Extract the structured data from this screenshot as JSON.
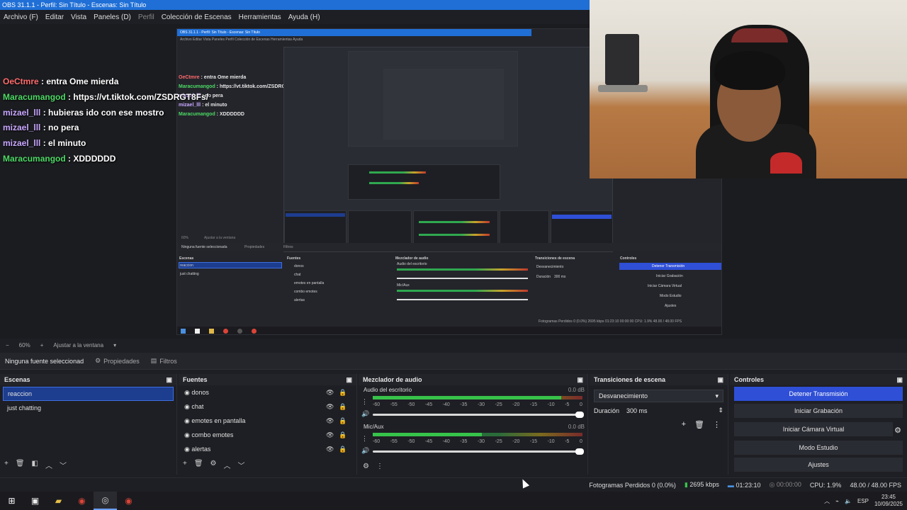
{
  "window": {
    "title": "OBS 31.1.1 - Perfil: Sin Título - Escenas: Sin Título"
  },
  "menu": [
    "Archivo (F)",
    "Editar",
    "Vista",
    "Paneles (D)",
    "Perfil",
    "Colección de Escenas",
    "Herramientas",
    "Ayuda (H)"
  ],
  "chat": [
    {
      "user": "OeCtmre",
      "sep": " : ",
      "msg": "entra Ome mierda",
      "color": "#ff6b6b"
    },
    {
      "user": "Maracumangod",
      "sep": " : ",
      "msg": "https://vt.tiktok.com/ZSDRGT8Fs/",
      "color": "#4cd964"
    },
    {
      "user": "mizael_lll",
      "sep": " : ",
      "msg": "hubieras ido con ese mostro",
      "color": "#c9a7ff"
    },
    {
      "user": "mizael_lll",
      "sep": " : ",
      "msg": "no pera",
      "color": "#c9a7ff"
    },
    {
      "user": "mizael_lll",
      "sep": " : ",
      "msg": "el minuto",
      "color": "#c9a7ff"
    },
    {
      "user": "Maracumangod",
      "sep": " : ",
      "msg": "XDDDDDD",
      "color": "#4cd964"
    }
  ],
  "zoom": {
    "level": "60%",
    "fit": "Ajustar a la ventana"
  },
  "props": {
    "no_source": "Ninguna fuente seleccionad",
    "properties": "Propiedades",
    "filters": "Filtros"
  },
  "scenes": {
    "title": "Escenas",
    "items": [
      "reaccion",
      "just chatting"
    ],
    "selected": 0
  },
  "sources": {
    "title": "Fuentes",
    "items": [
      "donos",
      "chat",
      "emotes en pantalla",
      "combo emotes",
      "alertas"
    ]
  },
  "mixer": {
    "title": "Mezclador de audio",
    "channels": [
      {
        "name": "Audio del escritorio",
        "db": "0.0 dB",
        "level": 0.9
      },
      {
        "name": "Mic/Aux",
        "db": "0.0 dB",
        "level": 0.52
      }
    ],
    "scale": [
      "-60",
      "-55",
      "-50",
      "-45",
      "-40",
      "-35",
      "-30",
      "-25",
      "-20",
      "-15",
      "-10",
      "-5",
      "0"
    ]
  },
  "transitions": {
    "title": "Transiciones de escena",
    "type": "Desvanecimiento",
    "duration_label": "Duración",
    "duration": "300 ms"
  },
  "controls": {
    "title": "Controles",
    "stop_stream": "Detener Transmisión",
    "start_rec": "Iniciar Grabación",
    "virtual_cam": "Iniciar Cámara Virtual",
    "studio": "Modo Estudio",
    "settings": "Ajustes"
  },
  "status": {
    "dropped": "Fotogramas Perdidos 0 (0.0%)",
    "bitrate": "2695 kbps",
    "stream_time": "01:23:10",
    "rec_time": "00:00:00",
    "cpu": "CPU: 1.9%",
    "fps": "48.00 / 48.00 FPS"
  },
  "taskbar": {
    "lang": "ESP",
    "time": "23:45",
    "date": "10/09/2025"
  },
  "nested": {
    "title": "OBS 31.1.1 - Perfil: Sin Título - Escenas: Sin Título",
    "menu": "Archivo Editar Vista Paneles Perfil Colección de Escenas Herramientas Ayuda",
    "chat": [
      {
        "user": "OeCtmre",
        "msg": " : entra Ome mierda",
        "color": "#ff6b6b"
      },
      {
        "user": "Maracumangod",
        "msg": " : https://vt.tiktok.com/ZSDRGT8Fs/ : hubieras ido con ese mostro",
        "color": "#4cd964"
      },
      {
        "user": "mizael_lll",
        "msg": " : no pera",
        "color": "#c9a7ff"
      },
      {
        "user": "mizael_lll",
        "msg": " : el minuto",
        "color": "#c9a7ff"
      },
      {
        "user": "Maracumangod",
        "msg": " : XDDDDDD",
        "color": "#4cd964"
      }
    ],
    "no_source": "Ninguna fuente seleccionada",
    "props": "Propiedades",
    "filters": "Filtros",
    "zoom": "60%",
    "fit": "Ajustar a la ventana",
    "scenes_title": "Escenas",
    "scenes": [
      "reaccion",
      "just chatting"
    ],
    "sources_title": "Fuentes",
    "sources": [
      "donos",
      "chat",
      "emotes en pantalla",
      "combo emotes",
      "alertas"
    ],
    "mixer_title": "Mezclador de audio",
    "mixer_ch1": "Audio del escritorio",
    "mixer_ch2": "Mic/Aux",
    "trans_title": "Transiciones de escena",
    "trans_type": "Desvanecimiento",
    "trans_dur_label": "Duración",
    "trans_dur": "300 ms",
    "controls_title": "Controles",
    "controls": [
      "Detener Transmisión",
      "Iniciar Grabación",
      "Iniciar Cámara Virtual",
      "Modo Estudio",
      "Ajustes"
    ],
    "status": "Fotogramas Perdidos 0 (0.0%)  2695 kbps  01:23:10  00:00:00  CPU: 1.9%  48.00 / 48.00 FPS"
  }
}
